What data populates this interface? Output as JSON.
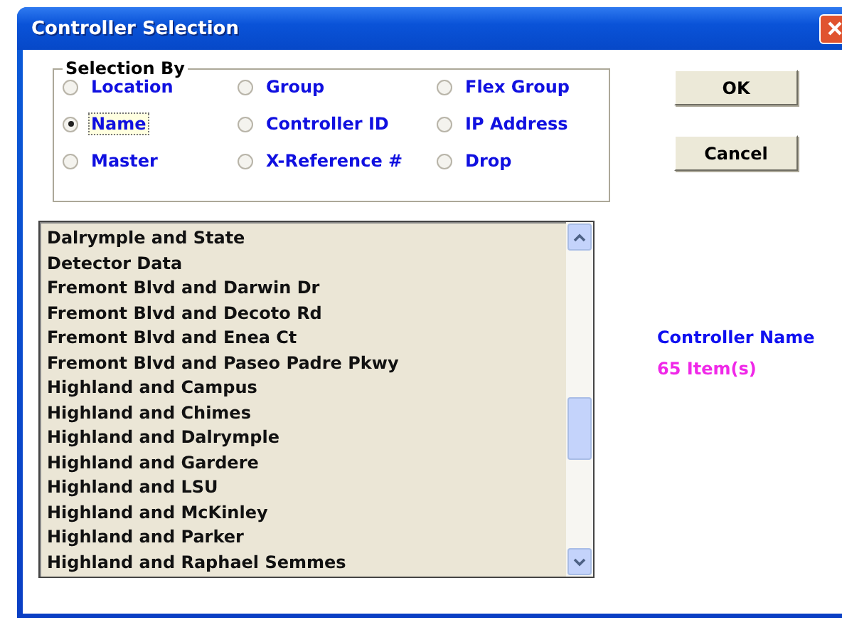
{
  "window": {
    "title": "Controller Selection"
  },
  "selection_by": {
    "label": "Selection By",
    "options": [
      {
        "label": "Location",
        "selected": false
      },
      {
        "label": "Group",
        "selected": false
      },
      {
        "label": "Flex Group",
        "selected": false
      },
      {
        "label": "Name",
        "selected": true
      },
      {
        "label": "Controller ID",
        "selected": false
      },
      {
        "label": "IP Address",
        "selected": false
      },
      {
        "label": "Master",
        "selected": false
      },
      {
        "label": "X-Reference #",
        "selected": false
      },
      {
        "label": "Drop",
        "selected": false
      }
    ]
  },
  "buttons": [
    "OK",
    "Cancel"
  ],
  "list": {
    "items": [
      "Dalrymple and State",
      "Detector Data",
      "Fremont Blvd and Darwin Dr",
      "Fremont Blvd and Decoto Rd",
      "Fremont Blvd and Enea Ct",
      "Fremont Blvd and Paseo Padre Pkwy",
      "Highland and Campus",
      "Highland and Chimes",
      "Highland and Dalrymple",
      "Highland and Gardere",
      "Highland and LSU",
      "Highland and McKinley",
      "Highland and Parker",
      "Highland and Raphael Semmes"
    ]
  },
  "info": {
    "heading": "Controller Name",
    "count": "65 Item(s)"
  }
}
